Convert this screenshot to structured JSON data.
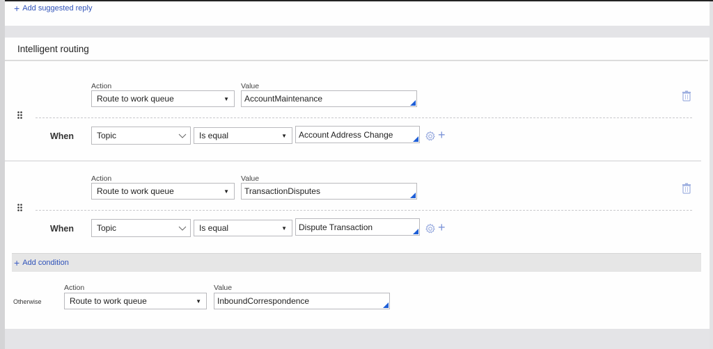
{
  "top_card": {
    "add_suggested_reply": "Add suggested reply"
  },
  "routing": {
    "title": "Intelligent routing",
    "rules": [
      {
        "action_label": "Action",
        "action_value": "Route to work queue",
        "value_label": "Value",
        "value": "AccountMaintenance",
        "when_label": "When",
        "condition_field": "Topic",
        "condition_operator": "Is equal",
        "condition_value": "Account Address Change"
      },
      {
        "action_label": "Action",
        "action_value": "Route to work queue",
        "value_label": "Value",
        "value": "TransactionDisputes",
        "when_label": "When",
        "condition_field": "Topic",
        "condition_operator": "Is equal",
        "condition_value": "Dispute Transaction"
      }
    ],
    "add_condition": "Add condition",
    "otherwise": {
      "label": "Otherwise",
      "action_label": "Action",
      "action_value": "Route to work queue",
      "value_label": "Value",
      "value": "InboundCorrespondence"
    }
  },
  "icons": {
    "plus": "+",
    "caret": "▼"
  },
  "colors": {
    "link": "#2f52b9",
    "accent_corner": "#1f5fd6",
    "icon_muted": "#8fa3dc"
  }
}
